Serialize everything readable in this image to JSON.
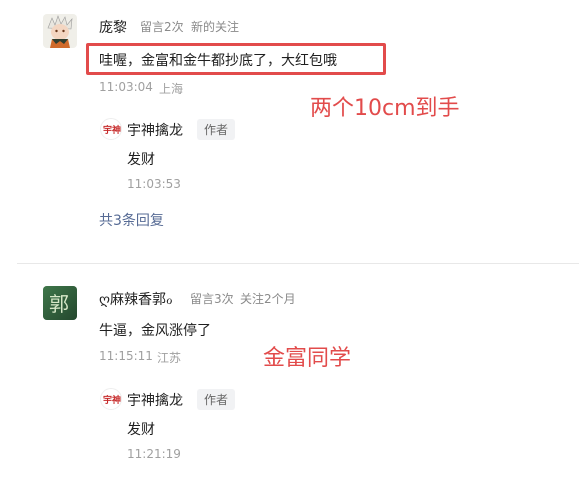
{
  "comments": [
    {
      "username": "庞黎",
      "meta_count": "留言2次",
      "meta_status": "新的关注",
      "text": "哇喔，金富和金牛都抄底了，大红包哦",
      "time": "11:03:04",
      "location": "上海",
      "annotation": "两个10cm到手",
      "reply": {
        "author": "宇神擒龙",
        "tag": "作者",
        "text": "发财",
        "time": "11:03:53"
      },
      "more_replies": "共3条回复"
    },
    {
      "username": "ღ麻辣香郭ℴ",
      "meta_count": "留言3次",
      "meta_status": "关注2个月",
      "text": "牛逼，金风涨停了",
      "time": "11:15:11",
      "location": "江苏",
      "annotation": "金富同学",
      "reply": {
        "author": "宇神擒龙",
        "tag": "作者",
        "text": "发财",
        "time": "11:21:19"
      }
    }
  ],
  "icons": {
    "avatar1": "anime-character-avatar-icon",
    "avatar2": "green-calligraphy-avatar-icon",
    "author_logo": "red-calligraphy-logo-icon"
  },
  "colors": {
    "annotation": "#e24b4b",
    "link": "#576b95",
    "meta": "#8a8a8a"
  }
}
